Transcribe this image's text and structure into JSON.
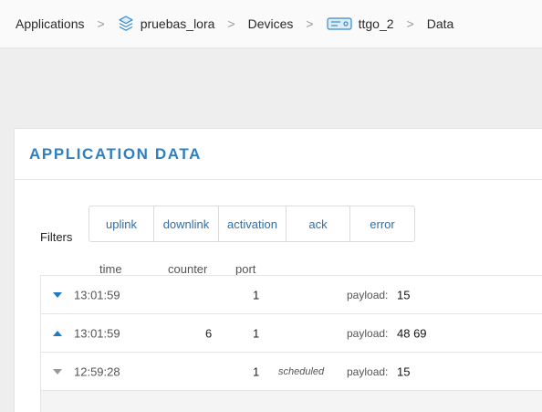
{
  "breadcrumb": {
    "applications": "Applications",
    "app": "pruebas_lora",
    "devices": "Devices",
    "device": "ttgo_2",
    "data": "Data",
    "separator": ">"
  },
  "card": {
    "title": "APPLICATION DATA"
  },
  "filters": {
    "label": "Filters",
    "items": [
      "uplink",
      "downlink",
      "activation",
      "ack",
      "error"
    ]
  },
  "columns": {
    "time": "time",
    "counter": "counter",
    "port": "port"
  },
  "rows": [
    {
      "direction": "down",
      "arrow_color": "#1f7bbf",
      "time": "13:01:59",
      "counter": "",
      "port": "1",
      "note": "",
      "payload_label": "payload:",
      "payload": "15"
    },
    {
      "direction": "up",
      "arrow_color": "#1f7bbf",
      "time": "13:01:59",
      "counter": "6",
      "port": "1",
      "note": "",
      "payload_label": "payload:",
      "payload": "48 69"
    },
    {
      "direction": "down",
      "arrow_color": "#9a9a9a",
      "time": "12:59:28",
      "counter": "",
      "port": "1",
      "note": "scheduled",
      "payload_label": "payload:",
      "payload": "15"
    }
  ],
  "colors": {
    "accent": "#2f7fc1",
    "link": "#2f6fa6"
  }
}
